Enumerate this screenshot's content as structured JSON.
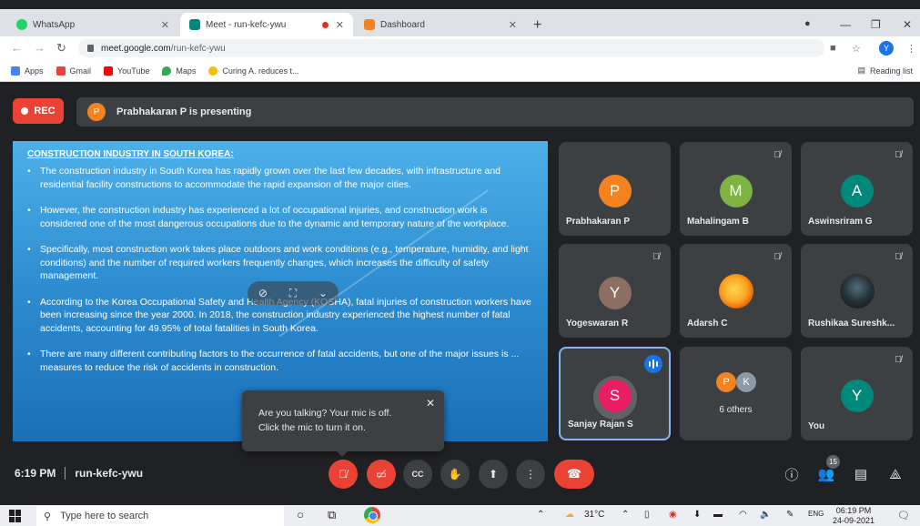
{
  "browser": {
    "tabs": [
      {
        "title": "WhatsApp",
        "active": false,
        "favicon_color": "#25d366"
      },
      {
        "title": "Meet - run-kefc-ywu",
        "active": true,
        "favicon_color": "#00897b"
      },
      {
        "title": "Dashboard",
        "active": false,
        "favicon_color": "#f6821f"
      }
    ],
    "url_host": "meet.google.com",
    "url_path": "/run-kefc-ywu",
    "profile_initial": "Y",
    "bookmarks": [
      "Apps",
      "Gmail",
      "YouTube",
      "Maps",
      "Curing A. reduces t..."
    ],
    "reading_list": "Reading list"
  },
  "meet": {
    "rec_label": "REC",
    "presenter_initial": "P",
    "presenting_text": "Prabhakaran P is presenting",
    "slide": {
      "heading": "CONSTRUCTION INDUSTRY IN SOUTH KOREA:",
      "bullets": [
        "The construction industry in South Korea has rapidly grown over the last few decades, with infrastructure and residential facility constructions to accommodate the rapid expansion of the major cities.",
        "However, the construction industry has experienced a lot of occupational injuries, and construction work is considered one of the most dangerous occupations due to the dynamic and temporary nature of the workplace.",
        "Specifically, most construction work takes place outdoors and work conditions (e.g., temperature, humidity, and light conditions) and the number of required workers frequently changes, which increases the difficulty of safety management.",
        "According to the Korea Occupational Safety and Health Agency (KOSHA), fatal injuries of construction workers have been increasing since the year 2000. In 2018, the construction industry experienced the highest number of fatal accidents, accounting for 49.95% of total fatalities in South Korea.",
        "There are many different contributing factors to the occurrence of fatal accidents, but one of the major issues is ... measures to reduce the risk of accidents in construction."
      ]
    },
    "tooltip": {
      "line1": "Are you talking? Your mic is off.",
      "line2": "Click the mic to turn it on."
    },
    "participants": [
      {
        "name": "Prabhakaran P",
        "initial": "P",
        "color": "#f6821f"
      },
      {
        "name": "Mahalingam B",
        "initial": "M",
        "color": "#7cb342"
      },
      {
        "name": "Aswinsriram G",
        "initial": "A",
        "color": "#00897b"
      },
      {
        "name": "Yogeswaran R",
        "initial": "Y",
        "color": "#8d6e63"
      },
      {
        "name": "Adarsh C",
        "initial": "",
        "color": "#f9a825"
      },
      {
        "name": "Rushikaa Sureshk...",
        "initial": "",
        "color": "#263238"
      },
      {
        "name": "Sanjay Rajan S",
        "initial": "S",
        "color": "#e91e63"
      },
      {
        "name": "6 others",
        "initial": "",
        "color": ""
      },
      {
        "name": "You",
        "initial": "Y",
        "color": "#00897b"
      }
    ],
    "others_initials": [
      "P",
      "K"
    ],
    "others_colors": [
      "#f6821f",
      "#8c9aa6"
    ],
    "time": "6:19 PM",
    "meeting_code": "run-kefc-ywu",
    "people_count": "15"
  },
  "taskbar": {
    "search_placeholder": "Type here to search",
    "weather": "31°C",
    "language": "ENG",
    "time": "06:19 PM",
    "date": "24-09-2021"
  }
}
